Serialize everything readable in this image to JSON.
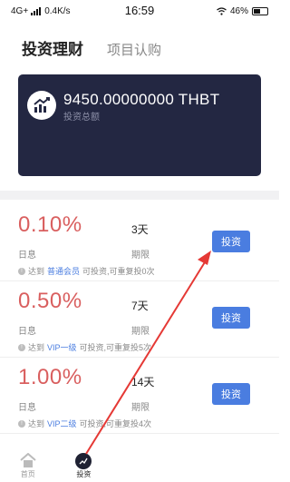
{
  "status_bar": {
    "network": "4G+",
    "speed": "0.4K/s",
    "time": "16:59",
    "battery": "46%"
  },
  "tabs": [
    {
      "label": "投资理财",
      "active": true
    },
    {
      "label": "项目认购",
      "active": false
    }
  ],
  "summary": {
    "amount": "9450.00000000 THBT",
    "label": "投资总额"
  },
  "products": [
    {
      "rate": "0.10%",
      "rate_label": "日息",
      "days": "3天",
      "days_label": "期限",
      "button": "投资",
      "note_prefix": "达到",
      "note_level": "普通会员",
      "note_suffix": "可投资,可重复投0次"
    },
    {
      "rate": "0.50%",
      "rate_label": "日息",
      "days": "7天",
      "days_label": "期限",
      "button": "投资",
      "note_prefix": "达到",
      "note_level": "VIP一级",
      "note_suffix": "可投资,可重复投5次"
    },
    {
      "rate": "1.00%",
      "rate_label": "日息",
      "days": "14天",
      "days_label": "期限",
      "button": "投资",
      "note_prefix": "达到",
      "note_level": "VIP二级",
      "note_suffix": "可投资,可重复投4次"
    }
  ],
  "tabbar": [
    {
      "label": "首页",
      "icon": "home-icon",
      "active": false
    },
    {
      "label": "投资",
      "icon": "chart-icon",
      "active": true
    },
    {
      "label": "",
      "icon": "blank",
      "active": false
    },
    {
      "label": "",
      "icon": "blank",
      "active": false
    },
    {
      "label": "",
      "icon": "blank",
      "active": false
    }
  ],
  "colors": {
    "card_bg": "#232742",
    "rate": "#d95f5f",
    "button": "#4a7de0",
    "annotation_arrow": "#e53935"
  }
}
